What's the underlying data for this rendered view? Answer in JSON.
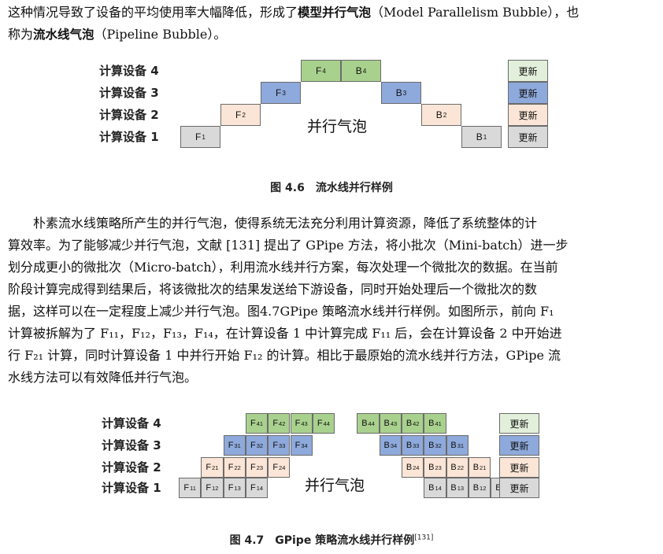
{
  "colors": {
    "dev1": "#d9d9d9",
    "dev2": "#fbe5d6",
    "dev3": "#8ea9db",
    "dev4": "#a9d18e",
    "update1": "#d9d9d9",
    "update2": "#fbe5d6",
    "update3": "#8ea9db",
    "update4": "#e2efda"
  },
  "intro": {
    "line1_a": "这种情况导致了设备的平均使用率大幅降低，形成了",
    "line1_b": "模型并行气泡",
    "line1_c": "（Model Parallelism Bubble），也",
    "line2_a": "称为",
    "line2_b": "流水线气泡",
    "line2_c": "（Pipeline Bubble）。"
  },
  "figure1": {
    "devices": [
      "计算设备 4",
      "计算设备 3",
      "计算设备 2",
      "计算设备 1"
    ],
    "bubble_label": "并行气泡",
    "update_label": "更新",
    "caption": "图 4.6　流水线并行样例",
    "forward": [
      "F",
      "F",
      "F",
      "F"
    ],
    "forward_subs": [
      "1",
      "2",
      "3",
      "4"
    ],
    "backward": [
      "B",
      "B",
      "B",
      "B"
    ],
    "backward_subs": [
      "4",
      "3",
      "2",
      "1"
    ]
  },
  "body": {
    "lines": [
      "　　朴素流水线策略所产生的并行气泡，使得系统无法充分利用计算资源，降低了系统整体的计",
      "算效率。为了能够减少并行气泡，文献 [131] 提出了 GPipe 方法，将小批次（Mini-batch）进一步",
      "划分成更小的微批次（Micro-batch），利用流水线并行方案，每次处理一个微批次的数据。在当前",
      "阶段计算完成得到结果后，将该微批次的结果发送给下游设备，同时开始处理后一个微批次的数",
      "据，这样可以在一定程度上减少并行气泡。图4.7GPipe 策略流水线并行样例。如图所示，前向 F₁",
      "计算被拆解为了 F₁₁，F₁₂，F₁₃，F₁₄，在计算设备 1 中计算完成 F₁₁ 后，会在计算设备 2 中开始进",
      "行 F₂₁ 计算，同时计算设备 1 中并行开始 F₁₂ 的计算。相比于最原始的流水线并行方法，GPipe 流",
      "水线方法可以有效降低并行气泡。"
    ]
  },
  "figure2": {
    "devices": [
      "计算设备 4",
      "计算设备 3",
      "计算设备 2",
      "计算设备 1"
    ],
    "bubble_label": "并行气泡",
    "update_label": "更新",
    "caption": "图 4.7　GPipe 策略流水线并行样例",
    "caption_ref": "[131]",
    "rows": [
      {
        "device": 4,
        "forward": [
          "F41",
          "F42",
          "F43",
          "F44"
        ],
        "backward": [
          "B44",
          "B43",
          "B42",
          "B41"
        ]
      },
      {
        "device": 3,
        "forward": [
          "F31",
          "F32",
          "F33",
          "F34"
        ],
        "backward": [
          "B34",
          "B33",
          "B32",
          "B31"
        ]
      },
      {
        "device": 2,
        "forward": [
          "F21",
          "F22",
          "F23",
          "F24"
        ],
        "backward": [
          "B24",
          "B23",
          "B22",
          "B21"
        ]
      },
      {
        "device": 1,
        "forward": [
          "F11",
          "F12",
          "F13",
          "F14"
        ],
        "backward": [
          "B14",
          "B13",
          "B12",
          "B11"
        ]
      }
    ]
  }
}
